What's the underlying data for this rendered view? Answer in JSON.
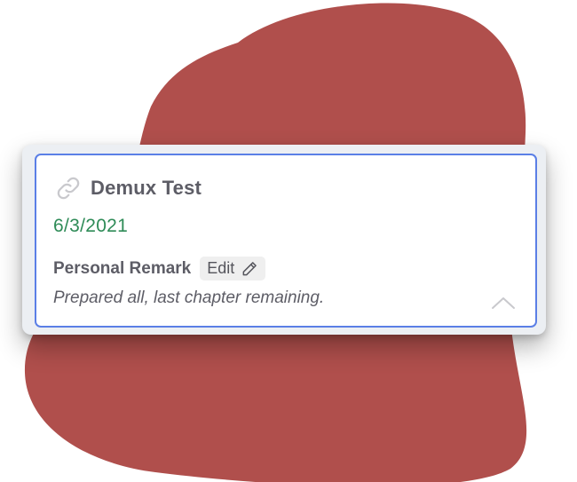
{
  "card": {
    "title": "Demux Test",
    "date": "6/3/2021",
    "remark_label": "Personal Remark",
    "edit_label": "Edit",
    "remark_text": "Prepared all, last chapter remaining."
  },
  "icons": {
    "link": "link-icon",
    "pencil": "pencil-icon",
    "collapse": "chevron-up-icon"
  },
  "colors": {
    "blob": "#b04f4c",
    "card_border": "#5b7fe6",
    "date": "#2e8b57",
    "text": "#5d5d66"
  }
}
